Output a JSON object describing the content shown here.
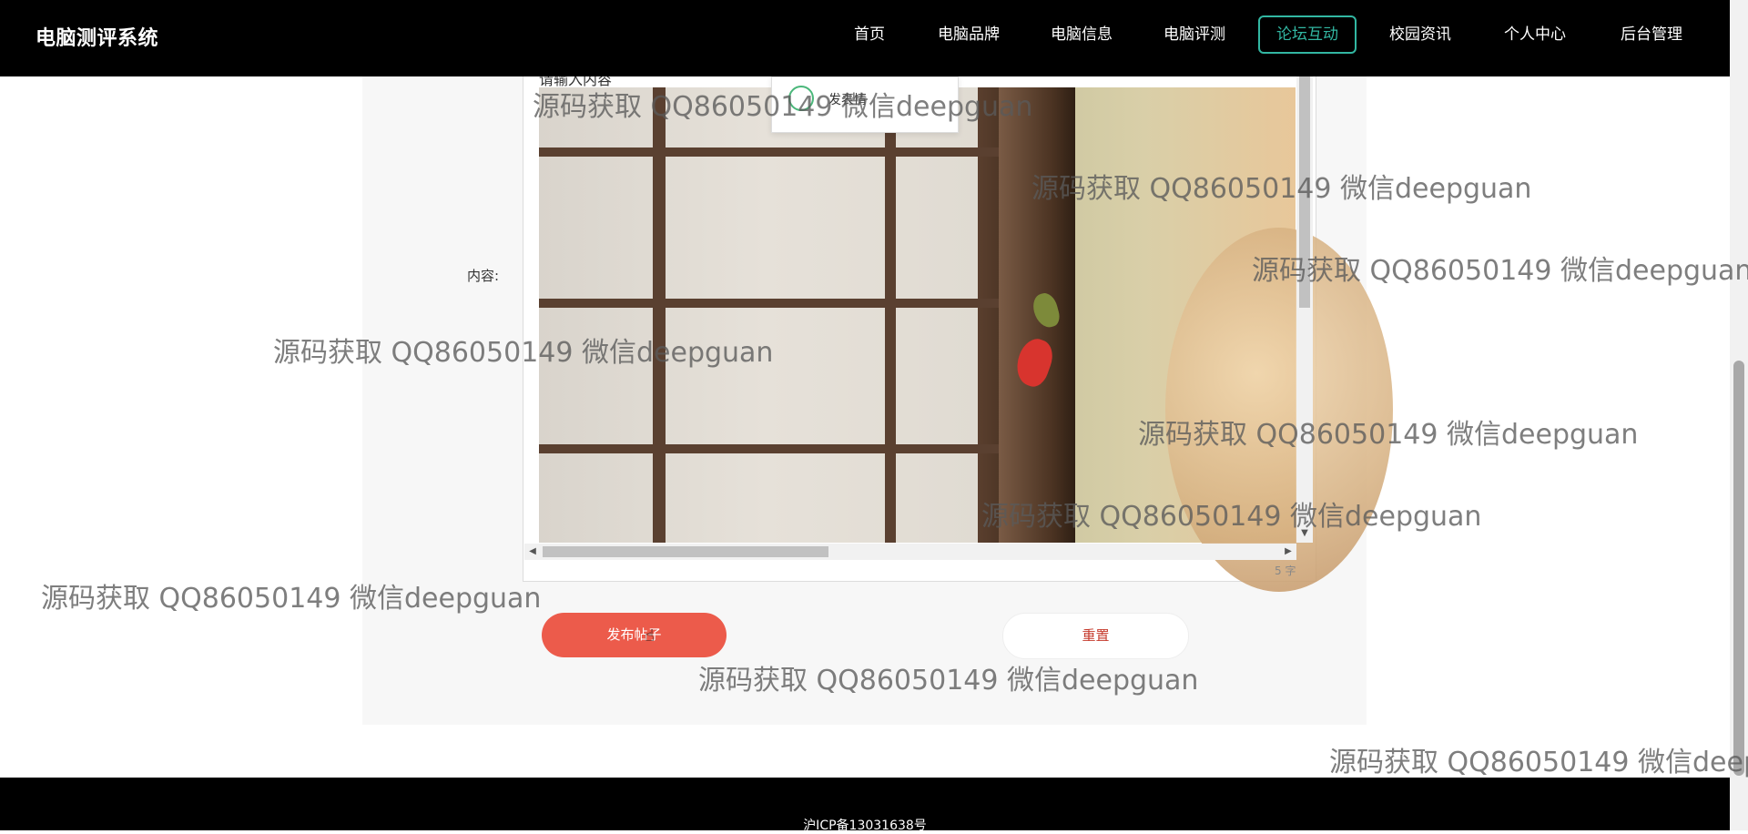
{
  "header": {
    "brand": "电脑测评系统",
    "nav": [
      {
        "label": "首页"
      },
      {
        "label": "电脑品牌"
      },
      {
        "label": "电脑信息"
      },
      {
        "label": "电脑评测"
      },
      {
        "label": "论坛互动"
      },
      {
        "label": "校园资讯"
      },
      {
        "label": "个人中心"
      },
      {
        "label": "后台管理"
      }
    ],
    "active_index": 4,
    "accent_color": "#32b7a2"
  },
  "form": {
    "content_label": "内容:",
    "editor": {
      "placeholder": "请输入内容",
      "word_count": "5 字",
      "emoji_popup_label": "发表情"
    },
    "submit_label": "发布帖子",
    "reset_label": "重置",
    "submit_color": "#ec5b4b"
  },
  "footer": {
    "icp": "沪ICP备13031638号"
  },
  "watermark": {
    "text": "源码获取 QQ86050149 微信deepguan",
    "text_cut": "源码获取 QQ86050149 微信deep"
  }
}
